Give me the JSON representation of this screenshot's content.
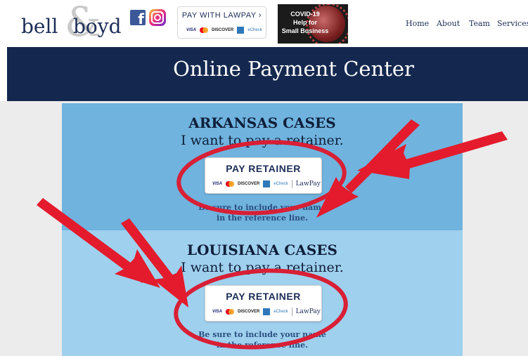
{
  "header": {
    "logo": {
      "word1": "bell",
      "ampersand": "&",
      "word2": "boyd"
    },
    "lawpay_badge": {
      "label": "PAY WITH LAWPAY ›",
      "cards": [
        "VISA",
        "DISCOVER",
        "eCheck"
      ]
    },
    "covid_badge": {
      "lines": [
        "COVID-19",
        "Help for",
        "Small Business"
      ]
    },
    "nav": [
      {
        "label": "Home"
      },
      {
        "label": "About"
      },
      {
        "label": "Team"
      },
      {
        "label": "Services"
      }
    ]
  },
  "banner": {
    "title": "Online Payment Center"
  },
  "sections": [
    {
      "heading": "ARKANSAS CASES",
      "subheading": "I want to pay a retainer.",
      "button": {
        "label": "PAY RETAINER",
        "cards": [
          "VISA",
          "DISCOVER",
          "eCheck",
          "LawPay"
        ]
      },
      "note": [
        "Be sure to include your name",
        "in the reference line."
      ]
    },
    {
      "heading": "LOUISIANA CASES",
      "subheading": "I want to pay a retainer.",
      "button": {
        "label": "PAY RETAINER",
        "cards": [
          "VISA",
          "DISCOVER",
          "eCheck",
          "LawPay"
        ]
      },
      "note": [
        "Be sure to include your name",
        "in the reference line."
      ]
    }
  ],
  "annotations": {
    "arrow_color": "#e31b2c",
    "ellipse_color": "#d81f35"
  },
  "colors": {
    "navy": "#14284f",
    "section1": "#6fb3de",
    "section2": "#9fd0ee",
    "background": "#ececec"
  }
}
